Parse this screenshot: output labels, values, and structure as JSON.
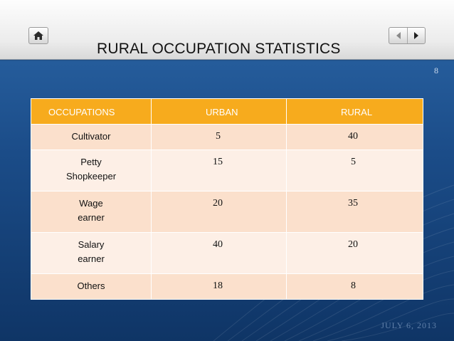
{
  "slide": {
    "title": "RURAL OCCUPATION STATISTICS",
    "page_number": "8",
    "footer_date": "JULY 6, 2013",
    "icons": {
      "home": "home-icon",
      "previous": "triangle-left-icon",
      "next": "triangle-right-icon"
    }
  },
  "colors": {
    "header": "#f7ab1d",
    "row_dark": "#fbe0cc",
    "row_light": "#fdefe6",
    "background": "#1b4c88"
  },
  "table": {
    "headers": [
      "OCCUPATIONS",
      "URBAN",
      "RURAL"
    ],
    "rows": [
      {
        "occupation": [
          "Cultivator"
        ],
        "urban": "5",
        "rural": "40"
      },
      {
        "occupation": [
          "Petty",
          "Shopkeeper"
        ],
        "urban": "15",
        "rural": "5"
      },
      {
        "occupation": [
          "Wage",
          "earner"
        ],
        "urban": "20",
        "rural": "35"
      },
      {
        "occupation": [
          "Salary",
          "earner"
        ],
        "urban": "40",
        "rural": "20"
      },
      {
        "occupation": [
          "Others"
        ],
        "urban": "18",
        "rural": "8"
      }
    ]
  }
}
